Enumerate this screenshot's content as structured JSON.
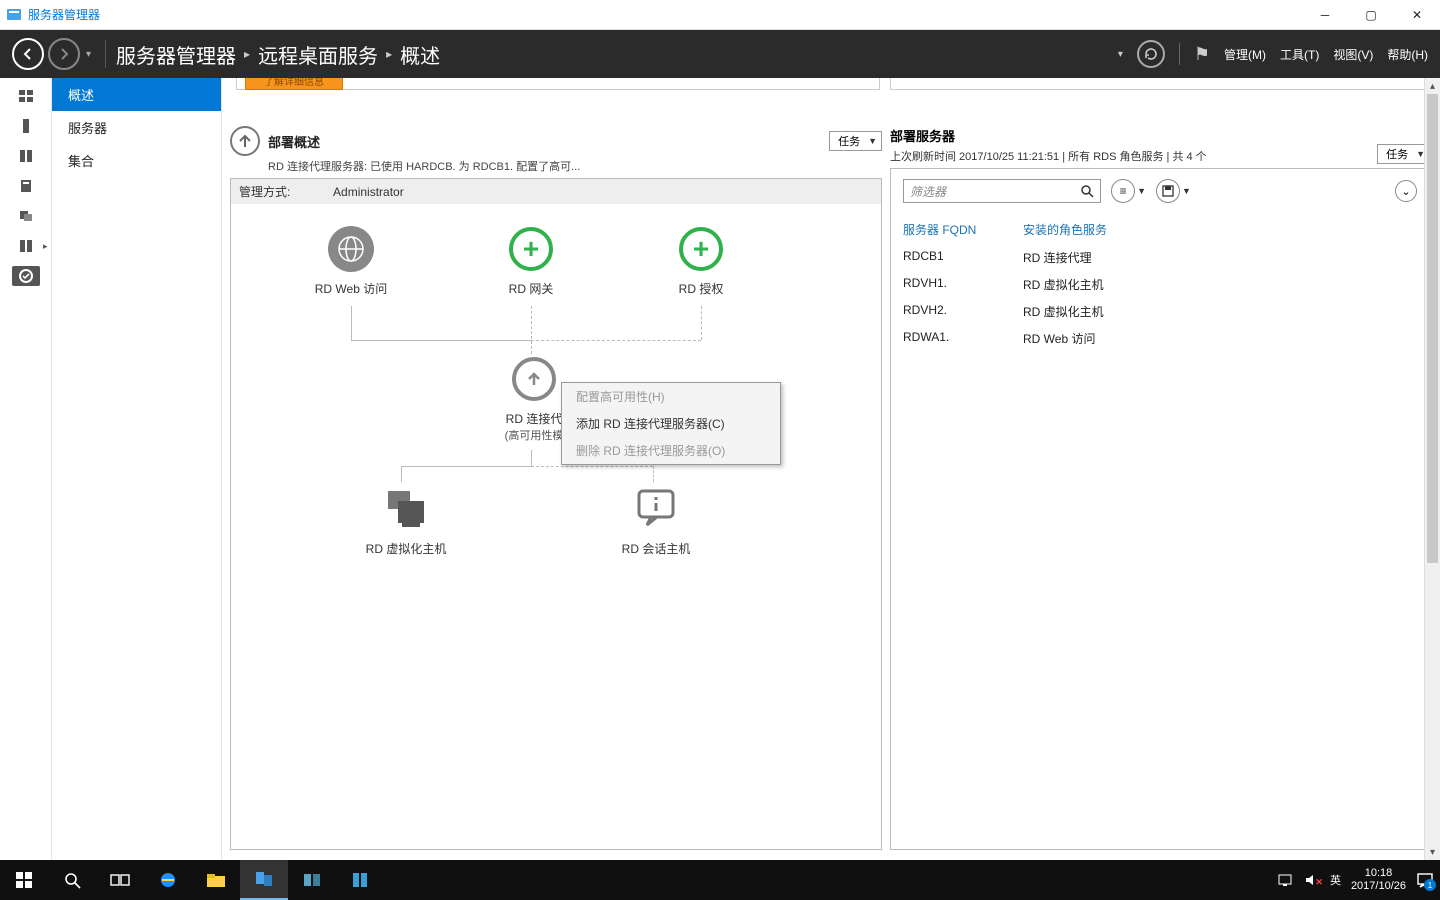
{
  "titlebar": {
    "title": "服务器管理器"
  },
  "header": {
    "breadcrumb": [
      "服务器管理器",
      "远程桌面服务",
      "概述"
    ],
    "menus": {
      "manage": "管理(M)",
      "tools": "工具(T)",
      "view": "视图(V)",
      "help": "帮助(H)"
    }
  },
  "sidenav": {
    "items": [
      {
        "label": "概述",
        "selected": true
      },
      {
        "label": "服务器",
        "selected": false
      },
      {
        "label": "集合",
        "selected": false
      }
    ]
  },
  "orange_bar": "了解详细信息",
  "deploy_overview": {
    "title": "部署概述",
    "subtitle": "RD 连接代理服务器: 已使用 HARDCB.            为 RDCB1.            配置了高可...",
    "tasks_label": "任务",
    "mgmt_label_prefix": "管理方式:",
    "mgmt_user": "Administrator",
    "nodes": {
      "web": "RD Web 访问",
      "gateway": "RD 网关",
      "license": "RD 授权",
      "broker": "RD 连接代",
      "broker_sub": "(高可用性模",
      "vhost": "RD 虚拟化主机",
      "shost": "RD 会话主机"
    }
  },
  "context_menu": {
    "items": [
      {
        "label": "配置高可用性(H)",
        "disabled": true
      },
      {
        "label": "添加 RD 连接代理服务器(C)",
        "disabled": false
      },
      {
        "label": "删除 RD 连接代理服务器(O)",
        "disabled": true
      }
    ]
  },
  "deploy_servers": {
    "title": "部署服务器",
    "subtitle": "上次刷新时间 2017/10/25 11:21:51 | 所有 RDS 角色服务  | 共 4 个",
    "tasks_label": "任务",
    "filter_placeholder": "筛选器",
    "columns": {
      "fqdn": "服务器 FQDN",
      "role": "安装的角色服务"
    },
    "rows": [
      {
        "fqdn": "RDCB1",
        "role": "RD 连接代理"
      },
      {
        "fqdn": "RDVH1.",
        "role": "RD 虚拟化主机"
      },
      {
        "fqdn": "RDVH2.",
        "role": "RD 虚拟化主机"
      },
      {
        "fqdn": "RDWA1.",
        "role": "RD Web 访问"
      }
    ]
  },
  "taskbar": {
    "ime": "英",
    "time": "10:18",
    "date": "2017/10/26",
    "notif_count": "1"
  }
}
